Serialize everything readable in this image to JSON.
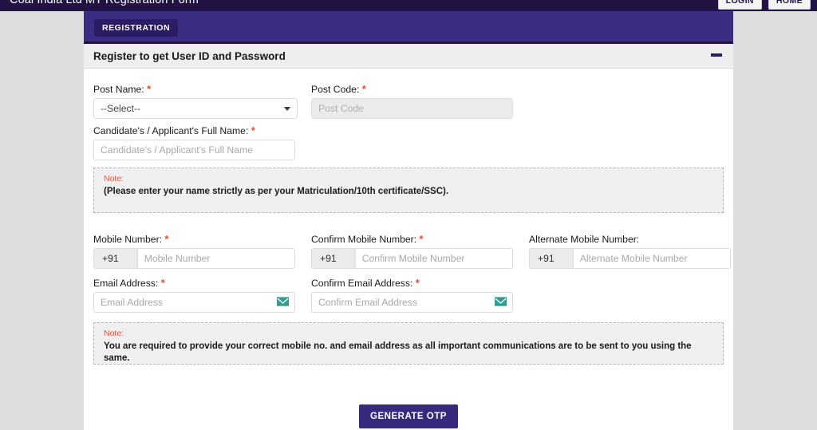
{
  "window": {
    "title": "Coal India Ltd MT Registration Form",
    "buttons": [
      {
        "label": "LOGIN",
        "name": "login-button"
      },
      {
        "label": "HOME",
        "name": "home-button"
      }
    ]
  },
  "registration_bar": {
    "tab_label": "REGISTRATION"
  },
  "panel": {
    "title": "Register to get User ID and Password",
    "collapse_icon": "minus-icon"
  },
  "form": {
    "post_name": {
      "label": "Post Name:",
      "required": "*",
      "selected": "--Select--",
      "options": [
        "--Select--"
      ]
    },
    "post_code": {
      "label": "Post Code:",
      "required": "*",
      "placeholder": "Post Code",
      "value": "",
      "disabled": true
    },
    "full_name": {
      "label": "Candidate's / Applicant's Full Name:",
      "required": "*",
      "placeholder": "Candidate's / Applicant's Full Name",
      "value": ""
    },
    "note_name": {
      "label": "Note:",
      "text": "(Please enter your name strictly as per your Matriculation/10th certificate/SSC)."
    },
    "mobile": {
      "label": "Mobile Number:",
      "required": "*",
      "prefix": "+91",
      "placeholder": "Mobile Number",
      "value": ""
    },
    "confirm_mobile": {
      "label": "Confirm Mobile Number:",
      "required": "*",
      "prefix": "+91",
      "placeholder": "Confirm Mobile Number",
      "value": ""
    },
    "alternate_mobile": {
      "label": "Alternate Mobile Number:",
      "required": "",
      "prefix": "+91",
      "placeholder": "Alternate Mobile Number",
      "value": ""
    },
    "email": {
      "label": "Email Address:",
      "required": "*",
      "placeholder": "Email Address",
      "value": "",
      "icon": "envelope-icon"
    },
    "confirm_email": {
      "label": "Confirm Email Address:",
      "required": "*",
      "placeholder": "Confirm Email Address",
      "value": "",
      "icon": "envelope-icon"
    },
    "note_contact": {
      "label": "Note:",
      "text": "You are required to provide your correct mobile no. and email address as all important communications are to be sent to you using the same."
    },
    "generate_otp": {
      "label": "GENERATE OTP"
    }
  },
  "colors": {
    "titlebar": "#221344",
    "registration_bar": "#3b2c84",
    "registration_tab": "#2b1c63",
    "panel_head": "#eeeeee",
    "required_asterisk": "#f04b2a",
    "note_label": "#f0503a",
    "note_bg": "#f0f0f0",
    "otp_button": "#352a7e",
    "envelope_icon": "#2f9e8f",
    "page_bg": "#dedede"
  }
}
